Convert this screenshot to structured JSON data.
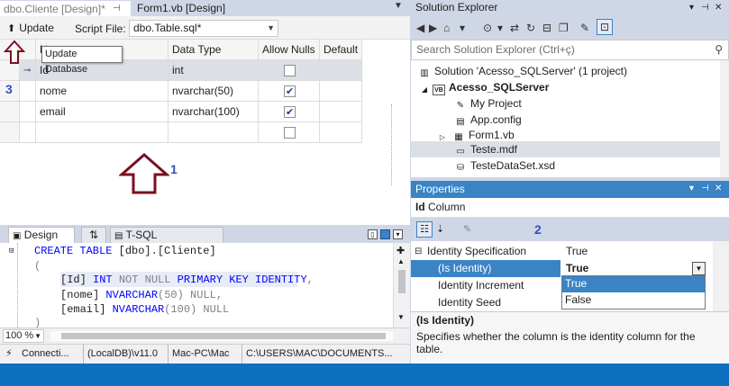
{
  "doc_tabs": [
    {
      "label": "dbo.Cliente [Design]*"
    },
    {
      "label": "Form1.vb [Design]"
    }
  ],
  "designer_toolbar": {
    "update_label": "Update",
    "script_file_label": "Script File:",
    "script_file_value": "dbo.Table.sql*",
    "tooltip": "Update Database"
  },
  "grid": {
    "headers": [
      "Name",
      "Data Type",
      "Allow Nulls",
      "Default"
    ],
    "rows": [
      {
        "name": "Id",
        "type": "int",
        "allow_nulls": false
      },
      {
        "name": "nome",
        "type": "nvarchar(50)",
        "allow_nulls": true
      },
      {
        "name": "email",
        "type": "nvarchar(100)",
        "allow_nulls": true
      },
      {
        "name": "",
        "type": "",
        "allow_nulls": false
      }
    ]
  },
  "annotations": {
    "one": "1",
    "two": "2",
    "three": "3"
  },
  "pane_tabs": {
    "design": "Design",
    "swap": "⇅",
    "tsql": "T-SQL"
  },
  "sql": {
    "line1_kw": "CREATE TABLE",
    "line1_rest": " [dbo].[Cliente]",
    "line2": "(",
    "line3_col": "[Id] ",
    "line3_type": "INT",
    "line3_nn": " NOT NULL ",
    "line3_pk": "PRIMARY KEY IDENTITY",
    "line3_end": ",",
    "line4_col": "[nome] ",
    "line4_type": "NVARCHAR",
    "line4_args": "(50) NULL,",
    "line5_col": "[email] ",
    "line5_type": "NVARCHAR",
    "line5_args": "(100) NULL",
    "line6": ")"
  },
  "zoom": {
    "value": "100 %"
  },
  "connection_bar": {
    "state": "Connecti...",
    "server": "(LocalDB)\\v11.0",
    "user": "Mac-PC\\Mac",
    "path": "C:\\USERS\\MAC\\DOCUMENTS..."
  },
  "solution_explorer": {
    "title": "Solution Explorer",
    "search_placeholder": "Search Solution Explorer (Ctrl+ç)",
    "tree": [
      {
        "label": "Solution 'Acesso_SQLServer' (1 project)",
        "icon": "solution-icon"
      },
      {
        "label": "Acesso_SQLServer",
        "icon": "vb-project-icon"
      },
      {
        "label": "My Project",
        "icon": "wrench-icon"
      },
      {
        "label": "App.config",
        "icon": "config-file-icon"
      },
      {
        "label": "Form1.vb",
        "icon": "form-icon"
      },
      {
        "label": "Teste.mdf",
        "icon": "database-file-icon"
      },
      {
        "label": "TesteDataSet.xsd",
        "icon": "dataset-icon"
      }
    ]
  },
  "properties": {
    "title": "Properties",
    "object_name": "Id",
    "object_type": "Column",
    "rows": [
      {
        "name": "Identity Specification",
        "value": "True"
      },
      {
        "name": "(Is Identity)",
        "value": "True"
      },
      {
        "name": "Identity Increment",
        "value": ""
      },
      {
        "name": "Identity Seed",
        "value": ""
      }
    ],
    "dropdown_options": [
      "True",
      "False"
    ],
    "desc_title": "(Is Identity)",
    "desc_text": "Specifies whether the column is the identity column for the table."
  },
  "colors": {
    "accent": "#3a84c5",
    "status_bar": "#0e70c0",
    "annotation_arrow": "#7a1020",
    "annotation_number": "#3050c0"
  }
}
